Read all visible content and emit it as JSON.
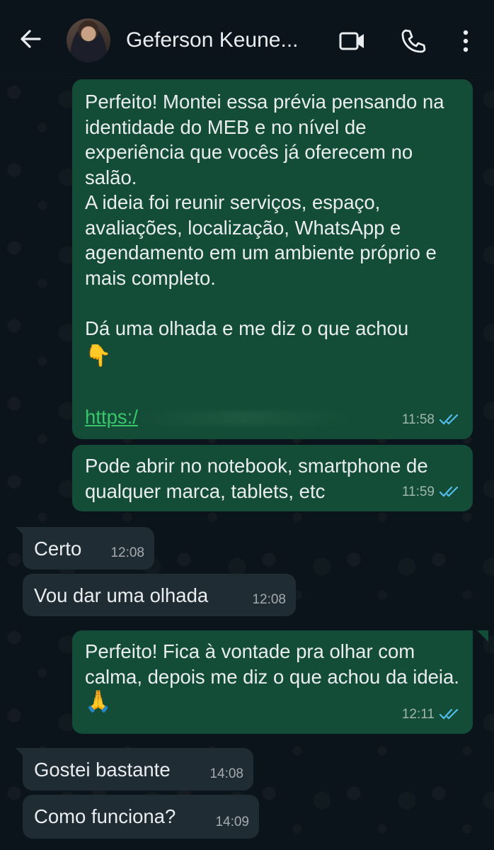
{
  "header": {
    "contact_name": "Geferson Keune...",
    "back_icon": "arrow-left-icon",
    "video_icon": "video-call-icon",
    "call_icon": "phone-icon",
    "menu_icon": "more-vert-icon"
  },
  "messages": [
    {
      "direction": "outgoing",
      "text": "Perfeito! Montei essa prévia pensando na identidade do MEB e no nível de experiência que vocês já oferecem no salão.\nA ideia foi reunir serviços, espaço, avaliações, localização, WhatsApp e agendamento em um ambiente próprio e mais completo.\n\nDá uma olhada e me diz o que achou",
      "emoji": "👇",
      "link": "https:/",
      "time": "11:58",
      "status": "read"
    },
    {
      "direction": "outgoing",
      "text": "Pode abrir no notebook, smartphone de qualquer marca, tablets, etc",
      "time": "11:59",
      "status": "read"
    },
    {
      "direction": "incoming",
      "text": "Certo",
      "time": "12:08"
    },
    {
      "direction": "incoming",
      "text": "Vou dar uma olhada",
      "time": "12:08"
    },
    {
      "direction": "outgoing",
      "text": "Perfeito! Fica à vontade pra olhar com calma, depois me diz o que achou da ideia.",
      "emoji": "🙏",
      "time": "12:11",
      "status": "read"
    },
    {
      "direction": "incoming",
      "text": "Gostei bastante",
      "time": "14:08"
    },
    {
      "direction": "incoming",
      "text": "Como funciona?",
      "time": "14:09"
    }
  ],
  "colors": {
    "background": "#0b141a",
    "outgoing_bubble": "#144d37",
    "incoming_bubble": "#202c33",
    "read_tick": "#53bdeb",
    "link": "#39c66a"
  }
}
